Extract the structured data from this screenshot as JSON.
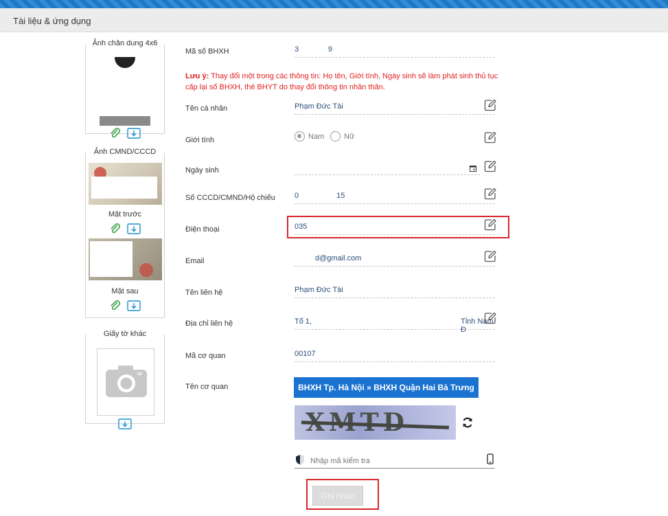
{
  "header": {
    "title": "Tài liệu & ứng dụng"
  },
  "sidebar": {
    "portrait_title": "Ảnh chân dung 4x6",
    "idcard_title": "Ảnh CMND/CCCD",
    "front_caption": "Mặt trước",
    "back_caption": "Mặt sau",
    "other_title": "Giấy tờ khác"
  },
  "form": {
    "bhxh": {
      "label": "Mã số BHXH",
      "value": "3              9"
    },
    "note": {
      "prefix": "Lưu ý:",
      "text": " Thay đổi một trong các thông tin: Họ tên, Giới tính, Ngày sinh sẽ làm phát sinh thủ tục cấp lại sổ BHXH, thẻ BHYT do thay đổi thông tin nhân thân."
    },
    "name": {
      "label": "Tên cá nhân",
      "value": "Phạm Đức Tài"
    },
    "gender": {
      "label": "Giới tính",
      "options": [
        "Nam",
        "Nữ"
      ],
      "selected": "Nam"
    },
    "dob": {
      "label": "Ngày sinh",
      "value": ""
    },
    "idnum": {
      "label": "Số CCCD/CMND/Hộ chiếu",
      "value": "0                  15"
    },
    "phone": {
      "label": "Điện thoại",
      "value": "035"
    },
    "email": {
      "label": "Email",
      "value": "d@gmail.com"
    },
    "contact_name": {
      "label": "Tên liên hệ",
      "value": "Phạm Đức Tài"
    },
    "address": {
      "label": "Địa chỉ liên hệ",
      "value": "Tổ 1,",
      "value_end": "Tỉnh Nam Đ"
    },
    "agency_code": {
      "label": "Mã cơ quan",
      "value": "00107"
    },
    "agency_name": {
      "label": "Tên cơ quan",
      "button": "BHXH Tp. Hà Nội » BHXH Quận Hai Bà Trưng"
    },
    "captcha": {
      "text": "XMTD",
      "placeholder": "Nhập mã kiểm tra"
    },
    "submit_label": "Ghi nhận"
  },
  "colors": {
    "accent": "#1b73d1",
    "note_red": "#e21e1e",
    "highlight_red": "#d6262b",
    "attach_green": "#3aa54a",
    "download_blue": "#1b8fd1"
  }
}
